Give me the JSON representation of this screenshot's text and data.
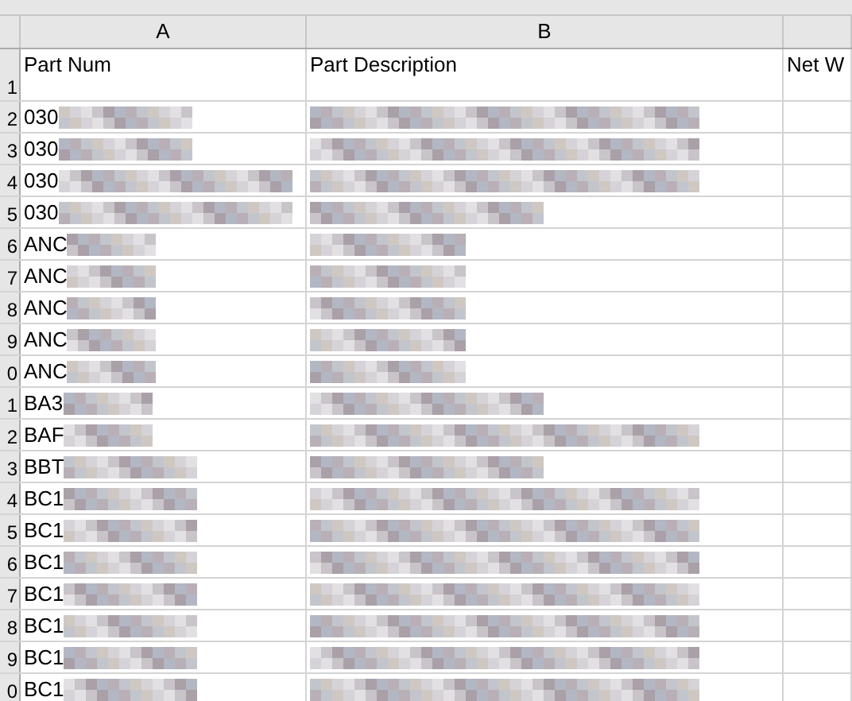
{
  "columns": [
    {
      "label": "A"
    },
    {
      "label": "B"
    },
    {}
  ],
  "rows": [
    {
      "number": "1",
      "cells": [
        {
          "text": "Part Num",
          "kind": "plain"
        },
        {
          "text": "Part Description",
          "kind": "plain"
        },
        {
          "text": "Net W",
          "kind": "plain"
        }
      ]
    },
    {
      "number": "2",
      "cells": [
        {
          "text": "030",
          "kind": "medium"
        },
        {
          "kind": "long"
        }
      ]
    },
    {
      "number": "3",
      "cells": [
        {
          "text": "030",
          "kind": "medium"
        },
        {
          "kind": "long"
        }
      ]
    },
    {
      "number": "4",
      "cells": [
        {
          "text": "030",
          "kind": "long"
        },
        {
          "kind": "long"
        }
      ]
    },
    {
      "number": "5",
      "cells": [
        {
          "text": "030",
          "kind": "long"
        },
        {
          "kind": "medium"
        }
      ]
    },
    {
      "number": "6",
      "cells": [
        {
          "text": "ANC",
          "kind": "short"
        },
        {
          "kind": "short"
        }
      ]
    },
    {
      "number": "7",
      "cells": [
        {
          "text": "ANC",
          "kind": "short"
        },
        {
          "kind": "short"
        }
      ]
    },
    {
      "number": "8",
      "cells": [
        {
          "text": "ANC",
          "kind": "short"
        },
        {
          "kind": "short"
        }
      ]
    },
    {
      "number": "9",
      "cells": [
        {
          "text": "ANC",
          "kind": "short"
        },
        {
          "kind": "short"
        }
      ]
    },
    {
      "number": "0",
      "cells": [
        {
          "text": "ANC",
          "kind": "short"
        },
        {
          "kind": "short"
        }
      ]
    },
    {
      "number": "1",
      "cells": [
        {
          "text": "BA3",
          "kind": "short"
        },
        {
          "kind": "medium"
        }
      ]
    },
    {
      "number": "2",
      "cells": [
        {
          "text": "BAF",
          "kind": "short"
        },
        {
          "kind": "long"
        }
      ]
    },
    {
      "number": "3",
      "cells": [
        {
          "text": "BBT",
          "kind": "medium"
        },
        {
          "kind": "medium"
        }
      ]
    },
    {
      "number": "4",
      "cells": [
        {
          "text": "BC1",
          "kind": "medium"
        },
        {
          "kind": "long"
        }
      ]
    },
    {
      "number": "5",
      "cells": [
        {
          "text": "BC1",
          "kind": "medium"
        },
        {
          "kind": "long"
        }
      ]
    },
    {
      "number": "6",
      "cells": [
        {
          "text": "BC1",
          "kind": "medium"
        },
        {
          "kind": "long"
        }
      ]
    },
    {
      "number": "7",
      "cells": [
        {
          "text": "BC1",
          "kind": "medium"
        },
        {
          "kind": "long"
        }
      ]
    },
    {
      "number": "8",
      "cells": [
        {
          "text": "BC1",
          "kind": "medium"
        },
        {
          "kind": "long"
        }
      ]
    },
    {
      "number": "9",
      "cells": [
        {
          "text": "BC1",
          "kind": "medium"
        },
        {
          "kind": "long"
        }
      ]
    },
    {
      "number": "0",
      "cells": [
        {
          "text": "BC1",
          "kind": "medium"
        },
        {
          "kind": "long"
        }
      ]
    }
  ]
}
